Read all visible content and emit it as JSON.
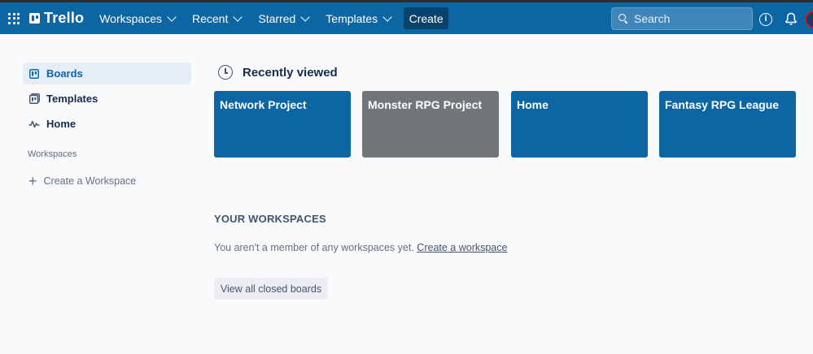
{
  "app": {
    "name": "Trello"
  },
  "nav": {
    "items": [
      {
        "label": "Workspaces"
      },
      {
        "label": "Recent"
      },
      {
        "label": "Starred"
      },
      {
        "label": "Templates"
      }
    ],
    "create_label": "Create"
  },
  "search": {
    "placeholder": "Search"
  },
  "sidebar": {
    "items": [
      {
        "label": "Boards",
        "icon": "board-icon",
        "active": true
      },
      {
        "label": "Templates",
        "icon": "template-icon",
        "active": false
      },
      {
        "label": "Home",
        "icon": "pulse-icon",
        "active": false
      }
    ],
    "workspaces_header": "Workspaces",
    "create_workspace_label": "Create a Workspace"
  },
  "recent": {
    "title": "Recently viewed",
    "boards": [
      {
        "title": "Network Project",
        "color": "#0c66a4"
      },
      {
        "title": "Monster RPG Project",
        "color": "#727679"
      },
      {
        "title": "Home",
        "color": "#0c66a4"
      },
      {
        "title": "Fantasy RPG League",
        "color": "#0c66a4"
      }
    ]
  },
  "workspaces": {
    "title": "YOUR WORKSPACES",
    "message": "You aren't a member of any workspaces yet.",
    "create_link": "Create a workspace",
    "closed_boards_label": "View all closed boards"
  }
}
